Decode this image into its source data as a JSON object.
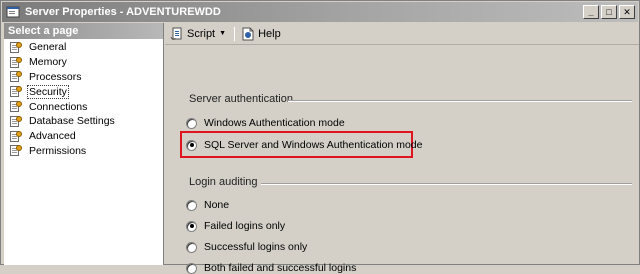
{
  "window": {
    "title": "Server Properties - ADVENTUREWDD",
    "buttons": [
      "_",
      "□",
      "✕"
    ]
  },
  "nav": {
    "header": "Select a page",
    "items": [
      {
        "label": "General",
        "selected": false
      },
      {
        "label": "Memory",
        "selected": false
      },
      {
        "label": "Processors",
        "selected": false
      },
      {
        "label": "Security",
        "selected": true
      },
      {
        "label": "Connections",
        "selected": false
      },
      {
        "label": "Database Settings",
        "selected": false
      },
      {
        "label": "Advanced",
        "selected": false
      },
      {
        "label": "Permissions",
        "selected": false
      }
    ],
    "item_icon": "page-wrench-icon"
  },
  "toolbar": {
    "script_label": "Script",
    "help_label": "Help",
    "script_icon": "script-icon",
    "help_icon": "help-icon"
  },
  "server_auth": {
    "label": "Server authentication",
    "options": [
      {
        "label": "Windows Authentication mode",
        "checked": false
      },
      {
        "label": "SQL Server and Windows Authentication mode",
        "checked": true
      }
    ],
    "highlight_color": "#e0141e"
  },
  "login_auditing": {
    "label": "Login auditing",
    "options": [
      {
        "label": "None",
        "checked": false
      },
      {
        "label": "Failed logins only",
        "checked": true
      },
      {
        "label": "Successful logins only",
        "checked": false
      },
      {
        "label": "Both failed and successful logins",
        "checked": false
      }
    ]
  }
}
